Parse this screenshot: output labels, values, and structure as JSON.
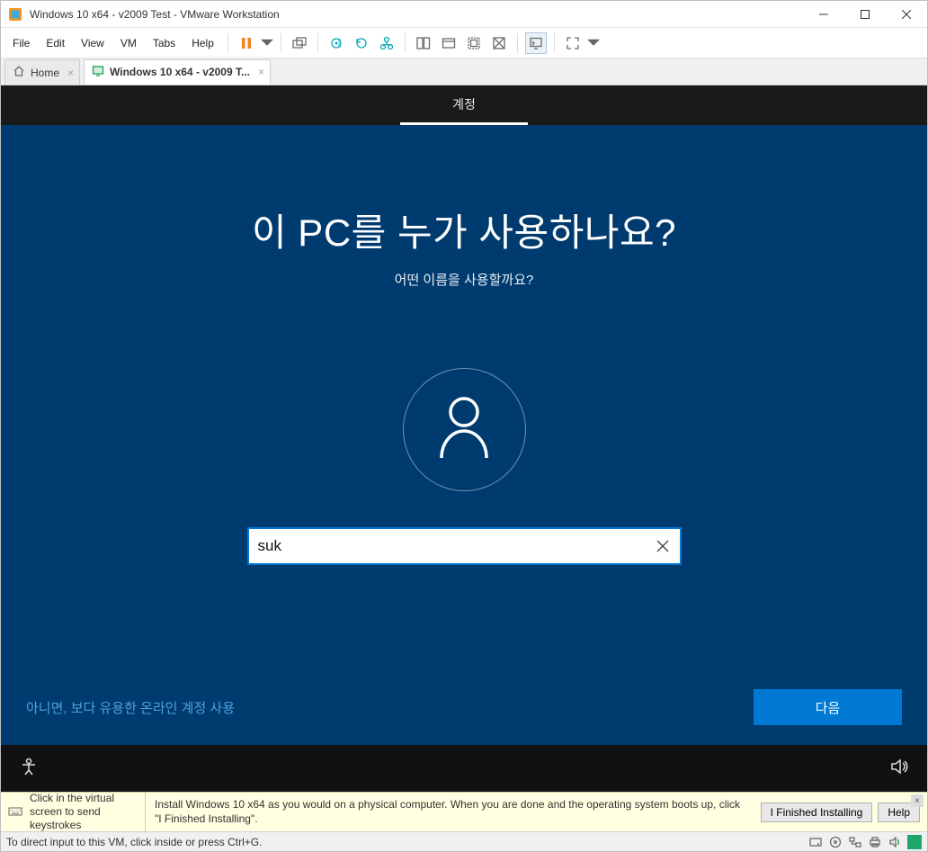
{
  "titlebar": {
    "title": "Windows 10 x64 - v2009 Test - VMware Workstation"
  },
  "menu": {
    "file": "File",
    "edit": "Edit",
    "view": "View",
    "vm": "VM",
    "tabs": "Tabs",
    "help": "Help"
  },
  "tabs": {
    "home": "Home",
    "vm": "Windows 10 x64 - v2009 T..."
  },
  "oobe": {
    "step": "계정",
    "heading": "이 PC를 누가 사용하나요?",
    "subtitle": "어떤 이름을 사용할까요?",
    "username_value": "suk",
    "online_link": "아니면, 보다 유용한 온라인 계정 사용",
    "next": "다음"
  },
  "hint": {
    "left": "Click in the virtual screen to send keystrokes",
    "mid": "Install Windows 10 x64 as you would on a physical computer. When you are done and the operating system boots up, click \"I Finished Installing\".",
    "finished": "I Finished Installing",
    "help": "Help"
  },
  "status": {
    "text": "To direct input to this VM, click inside or press Ctrl+G."
  }
}
